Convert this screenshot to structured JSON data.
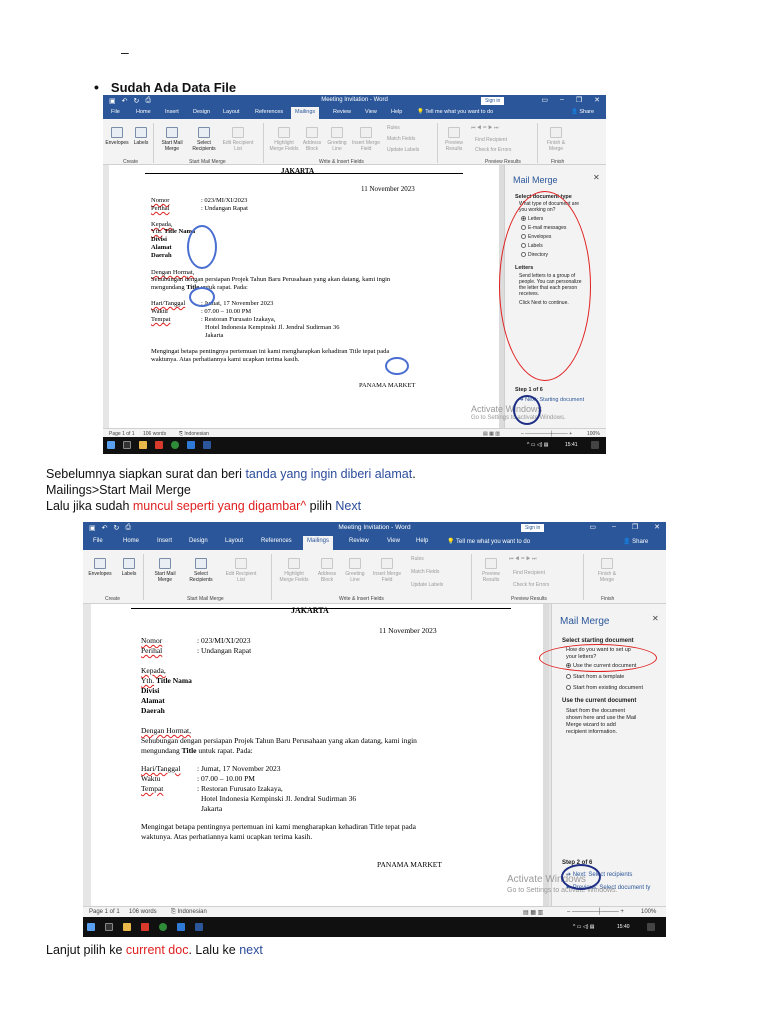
{
  "doc": {
    "dash": "–",
    "bullet": "•",
    "heading": "Sudah Ada Data File",
    "para1": {
      "a": "Sebelumnya siapkan surat dan beri ",
      "b": "tanda yang ingin diberi alamat",
      "c": "."
    },
    "para2": "Mailings>Start Mail Merge",
    "para3": {
      "a": "Lalu jika sudah ",
      "b": "muncul seperti yang digambar^",
      "c": " pilih ",
      "d": "Next"
    },
    "para4": {
      "a": "Lanjut pilih ke ",
      "b": "current doc",
      "c": ". Lalu ke ",
      "d": "next"
    }
  },
  "word": {
    "title": "Meeting Invitation - Word",
    "signin": "Sign in",
    "tabs": [
      "File",
      "Home",
      "Insert",
      "Design",
      "Layout",
      "References",
      "Mailings",
      "Review",
      "View",
      "Help"
    ],
    "tellme": "Tell me what you want to do",
    "share": "Share",
    "ribbon": {
      "envelopes": "Envelopes",
      "labels": "Labels",
      "start_mail_merge": "Start Mail Merge",
      "select_recipients": "Select Recipients",
      "edit_recipient_list": "Edit Recipient List",
      "highlight_merge_fields": "Highlight Merge Fields",
      "address_block": "Address Block",
      "greeting_line": "Greeting Line",
      "insert_merge_field": "Insert Merge Field",
      "rules": "Rules",
      "match_fields": "Match Fields",
      "update_labels": "Update Labels",
      "preview_results": "Preview Results",
      "find_recipient": "Find Recipient",
      "check_for_errors": "Check for Errors",
      "finish_merge": "Finish & Merge",
      "groups": [
        "Create",
        "Start Mail Merge",
        "Write & Insert Fields",
        "Preview Results",
        "Finish"
      ]
    },
    "letter": {
      "city": "JAKARTA",
      "date": "11 November 2023",
      "nomor_label": "Nomor",
      "nomor_value": ": 023/MI/XI/2023",
      "perihal_label": "Perihal",
      "perihal_value": ": Undangan Rapat",
      "kepada": "Kepada,",
      "yth": "Yth.",
      "yth_name": "Title Nama",
      "divisi": "Divisi",
      "alamat": "Alamat",
      "daerah": "Daerah",
      "salam": "Dengan Hormat,",
      "body1": "Sehubungan dengan persiapan Projek Tahun Baru Perusahaan yang akan datang, kami ingin",
      "body2a": "mengundang ",
      "body2_title": "Title",
      "body2b": " untuk rapat. Pada:",
      "hari_label": "Hari/Tanggal",
      "hari_value": ": Jumat, 17 November 2023",
      "waktu_label": "Waktu",
      "waktu_value": ": 07.00 – 10.00 PM",
      "tempat_label": "Tempat",
      "tempat_value": ": Restoran Furusato Izakaya,",
      "tempat_line2": "Hotel Indonesia Kempinski Jl. Jendral Sudirman 36",
      "tempat_line3": "Jakarta",
      "closing1": "Mengingat betapa pentingnya pertemuan ini kami mengharapkan kehadiran Title tepat pada",
      "closing2": "waktunya. Atas perhatiannya kami ucapkan terima kasih.",
      "signature": "PANAMA MARKET"
    },
    "pane1": {
      "title": "Mail Merge",
      "section": "Select document type",
      "question": [
        "What type of document are",
        "you working on?"
      ],
      "options": [
        "Letters",
        "E-mail messages",
        "Envelopes",
        "Labels",
        "Directory"
      ],
      "selected": 0,
      "desc_title": "Letters",
      "desc": [
        "Send letters to a group of",
        "people. You can personalize",
        "the letter that each person",
        "receives."
      ],
      "click_next": "Click Next to continue.",
      "step": "Step 1 of 6",
      "next": "Next: Starting document"
    },
    "pane2": {
      "title": "Mail Merge",
      "section": "Select starting document",
      "question": [
        "How do you want to set up",
        "your letters?"
      ],
      "options": [
        "Use the current document",
        "Start from a template",
        "Start from existing document"
      ],
      "selected": 0,
      "desc_title": "Use the current document",
      "desc": [
        "Start from the document",
        "shown here and use the Mail",
        "Merge wizard to add",
        "recipient information."
      ],
      "step": "Step 2 of 6",
      "next": "Next: Select recipients",
      "prev": "Previous: Select document ty"
    },
    "status": {
      "page": "Page 1 of 1",
      "words": "106 words",
      "lang": "Indonesian",
      "zoom": "100%"
    },
    "watermark1": "Activate Windows",
    "watermark2": "Go to Settings to activate Windows.",
    "time1": "15:41",
    "time2": "15:40"
  }
}
